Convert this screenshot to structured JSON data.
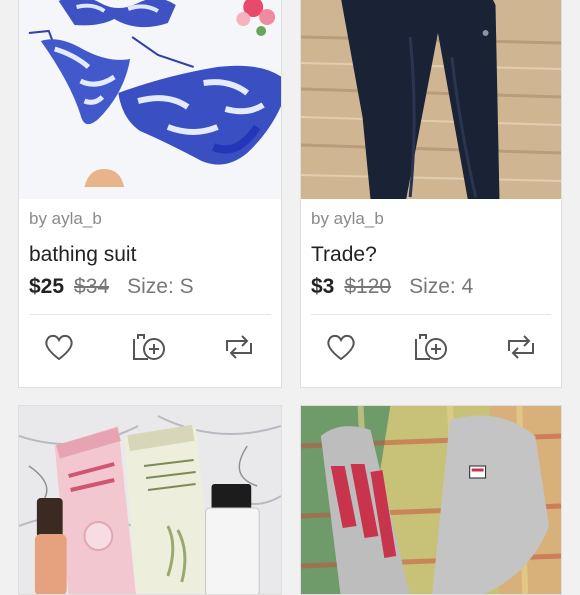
{
  "listings": [
    {
      "by": "by ayla_b",
      "title": "bathing suit",
      "price": "$25",
      "original_price": "$34",
      "size": "Size: S"
    },
    {
      "by": "by ayla_b",
      "title": "Trade?",
      "price": "$3",
      "original_price": "$120",
      "size": "Size: 4"
    },
    {},
    {}
  ],
  "icons": {
    "like": "heart-icon",
    "bundle": "add-to-bundle-icon",
    "share": "share-icon"
  },
  "colors": {
    "icon": "#555555",
    "price": "#222222",
    "muted": "#8a8a8a"
  }
}
